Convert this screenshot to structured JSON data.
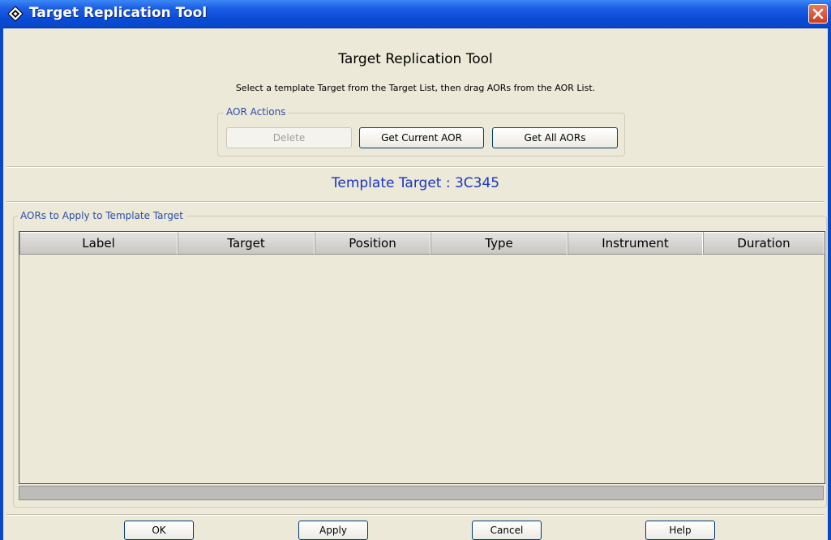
{
  "window": {
    "title": "Target Replication Tool",
    "close_icon": "close-icon"
  },
  "heading": "Target Replication Tool",
  "subtitle": "Select a template Target from the Target List, then drag AORs from the AOR List.",
  "aor_actions": {
    "legend": "AOR Actions",
    "delete_label": "Delete",
    "get_current_label": "Get Current AOR",
    "get_all_label": "Get All AORs"
  },
  "template_target": "Template Target : 3C345",
  "aors_table": {
    "legend": "AORs to Apply to Template Target",
    "columns": [
      "Label",
      "Target",
      "Position",
      "Type",
      "Instrument",
      "Duration"
    ],
    "rows": []
  },
  "footer": {
    "ok_label": "OK",
    "apply_label": "Apply",
    "cancel_label": "Cancel",
    "help_label": "Help"
  },
  "colors": {
    "titlebar": "#0a4bd6",
    "accent_text": "#1a34c4",
    "legend_text": "#2a4ea8",
    "window_bg": "#ece9d8"
  }
}
